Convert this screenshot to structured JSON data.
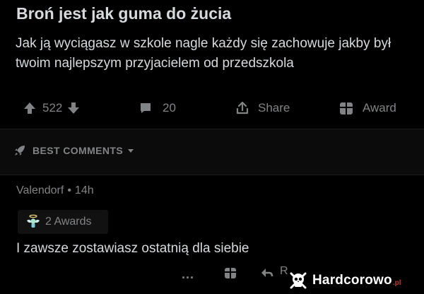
{
  "post": {
    "title": "Broń jest jak guma do żucia",
    "body": "Jak ją wyciągasz w szkole nagle każdy się zachowuje jakby był twoim najlepszym przyjacielem od przedszkola"
  },
  "actions": {
    "upvotes": "522",
    "comments": "20",
    "share_label": "Share",
    "award_label": "Award"
  },
  "sort": {
    "label": "BEST COMMENTS"
  },
  "comment": {
    "author": "Valendorf",
    "separator": "•",
    "age": "14h",
    "awards": "2 Awards",
    "text": "I zawsze zostawiasz ostatnią dla siebie",
    "more": "...",
    "reply_partial": "R"
  },
  "watermark": {
    "text": "Hardcorowo",
    "tld": ".pl"
  },
  "colors": {
    "background": "#000000",
    "text": "#d7dadc",
    "muted": "#818384"
  },
  "icons": [
    "upvote-icon",
    "downvote-icon",
    "comment-icon",
    "share-icon",
    "gift-icon",
    "rocket-icon",
    "chevron-down-icon",
    "angel-award-icon",
    "reply-icon",
    "skull-logo-icon"
  ]
}
